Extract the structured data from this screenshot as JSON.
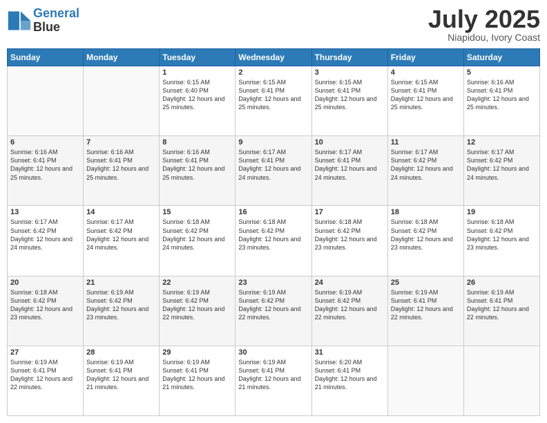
{
  "header": {
    "logo_line1": "General",
    "logo_line2": "Blue",
    "month": "July 2025",
    "location": "Niapidou, Ivory Coast"
  },
  "days_of_week": [
    "Sunday",
    "Monday",
    "Tuesday",
    "Wednesday",
    "Thursday",
    "Friday",
    "Saturday"
  ],
  "weeks": [
    [
      {
        "day": "",
        "sunrise": "",
        "sunset": "",
        "daylight": ""
      },
      {
        "day": "",
        "sunrise": "",
        "sunset": "",
        "daylight": ""
      },
      {
        "day": "1",
        "sunrise": "Sunrise: 6:15 AM",
        "sunset": "Sunset: 6:40 PM",
        "daylight": "Daylight: 12 hours and 25 minutes."
      },
      {
        "day": "2",
        "sunrise": "Sunrise: 6:15 AM",
        "sunset": "Sunset: 6:41 PM",
        "daylight": "Daylight: 12 hours and 25 minutes."
      },
      {
        "day": "3",
        "sunrise": "Sunrise: 6:15 AM",
        "sunset": "Sunset: 6:41 PM",
        "daylight": "Daylight: 12 hours and 25 minutes."
      },
      {
        "day": "4",
        "sunrise": "Sunrise: 6:15 AM",
        "sunset": "Sunset: 6:41 PM",
        "daylight": "Daylight: 12 hours and 25 minutes."
      },
      {
        "day": "5",
        "sunrise": "Sunrise: 6:16 AM",
        "sunset": "Sunset: 6:41 PM",
        "daylight": "Daylight: 12 hours and 25 minutes."
      }
    ],
    [
      {
        "day": "6",
        "sunrise": "Sunrise: 6:16 AM",
        "sunset": "Sunset: 6:41 PM",
        "daylight": "Daylight: 12 hours and 25 minutes."
      },
      {
        "day": "7",
        "sunrise": "Sunrise: 6:16 AM",
        "sunset": "Sunset: 6:41 PM",
        "daylight": "Daylight: 12 hours and 25 minutes."
      },
      {
        "day": "8",
        "sunrise": "Sunrise: 6:16 AM",
        "sunset": "Sunset: 6:41 PM",
        "daylight": "Daylight: 12 hours and 25 minutes."
      },
      {
        "day": "9",
        "sunrise": "Sunrise: 6:17 AM",
        "sunset": "Sunset: 6:41 PM",
        "daylight": "Daylight: 12 hours and 24 minutes."
      },
      {
        "day": "10",
        "sunrise": "Sunrise: 6:17 AM",
        "sunset": "Sunset: 6:41 PM",
        "daylight": "Daylight: 12 hours and 24 minutes."
      },
      {
        "day": "11",
        "sunrise": "Sunrise: 6:17 AM",
        "sunset": "Sunset: 6:42 PM",
        "daylight": "Daylight: 12 hours and 24 minutes."
      },
      {
        "day": "12",
        "sunrise": "Sunrise: 6:17 AM",
        "sunset": "Sunset: 6:42 PM",
        "daylight": "Daylight: 12 hours and 24 minutes."
      }
    ],
    [
      {
        "day": "13",
        "sunrise": "Sunrise: 6:17 AM",
        "sunset": "Sunset: 6:42 PM",
        "daylight": "Daylight: 12 hours and 24 minutes."
      },
      {
        "day": "14",
        "sunrise": "Sunrise: 6:17 AM",
        "sunset": "Sunset: 6:42 PM",
        "daylight": "Daylight: 12 hours and 24 minutes."
      },
      {
        "day": "15",
        "sunrise": "Sunrise: 6:18 AM",
        "sunset": "Sunset: 6:42 PM",
        "daylight": "Daylight: 12 hours and 24 minutes."
      },
      {
        "day": "16",
        "sunrise": "Sunrise: 6:18 AM",
        "sunset": "Sunset: 6:42 PM",
        "daylight": "Daylight: 12 hours and 23 minutes."
      },
      {
        "day": "17",
        "sunrise": "Sunrise: 6:18 AM",
        "sunset": "Sunset: 6:42 PM",
        "daylight": "Daylight: 12 hours and 23 minutes."
      },
      {
        "day": "18",
        "sunrise": "Sunrise: 6:18 AM",
        "sunset": "Sunset: 6:42 PM",
        "daylight": "Daylight: 12 hours and 23 minutes."
      },
      {
        "day": "19",
        "sunrise": "Sunrise: 6:18 AM",
        "sunset": "Sunset: 6:42 PM",
        "daylight": "Daylight: 12 hours and 23 minutes."
      }
    ],
    [
      {
        "day": "20",
        "sunrise": "Sunrise: 6:18 AM",
        "sunset": "Sunset: 6:42 PM",
        "daylight": "Daylight: 12 hours and 23 minutes."
      },
      {
        "day": "21",
        "sunrise": "Sunrise: 6:19 AM",
        "sunset": "Sunset: 6:42 PM",
        "daylight": "Daylight: 12 hours and 23 minutes."
      },
      {
        "day": "22",
        "sunrise": "Sunrise: 6:19 AM",
        "sunset": "Sunset: 6:42 PM",
        "daylight": "Daylight: 12 hours and 22 minutes."
      },
      {
        "day": "23",
        "sunrise": "Sunrise: 6:19 AM",
        "sunset": "Sunset: 6:42 PM",
        "daylight": "Daylight: 12 hours and 22 minutes."
      },
      {
        "day": "24",
        "sunrise": "Sunrise: 6:19 AM",
        "sunset": "Sunset: 6:42 PM",
        "daylight": "Daylight: 12 hours and 22 minutes."
      },
      {
        "day": "25",
        "sunrise": "Sunrise: 6:19 AM",
        "sunset": "Sunset: 6:41 PM",
        "daylight": "Daylight: 12 hours and 22 minutes."
      },
      {
        "day": "26",
        "sunrise": "Sunrise: 6:19 AM",
        "sunset": "Sunset: 6:41 PM",
        "daylight": "Daylight: 12 hours and 22 minutes."
      }
    ],
    [
      {
        "day": "27",
        "sunrise": "Sunrise: 6:19 AM",
        "sunset": "Sunset: 6:41 PM",
        "daylight": "Daylight: 12 hours and 22 minutes."
      },
      {
        "day": "28",
        "sunrise": "Sunrise: 6:19 AM",
        "sunset": "Sunset: 6:41 PM",
        "daylight": "Daylight: 12 hours and 21 minutes."
      },
      {
        "day": "29",
        "sunrise": "Sunrise: 6:19 AM",
        "sunset": "Sunset: 6:41 PM",
        "daylight": "Daylight: 12 hours and 21 minutes."
      },
      {
        "day": "30",
        "sunrise": "Sunrise: 6:19 AM",
        "sunset": "Sunset: 6:41 PM",
        "daylight": "Daylight: 12 hours and 21 minutes."
      },
      {
        "day": "31",
        "sunrise": "Sunrise: 6:20 AM",
        "sunset": "Sunset: 6:41 PM",
        "daylight": "Daylight: 12 hours and 21 minutes."
      },
      {
        "day": "",
        "sunrise": "",
        "sunset": "",
        "daylight": ""
      },
      {
        "day": "",
        "sunrise": "",
        "sunset": "",
        "daylight": ""
      }
    ]
  ]
}
